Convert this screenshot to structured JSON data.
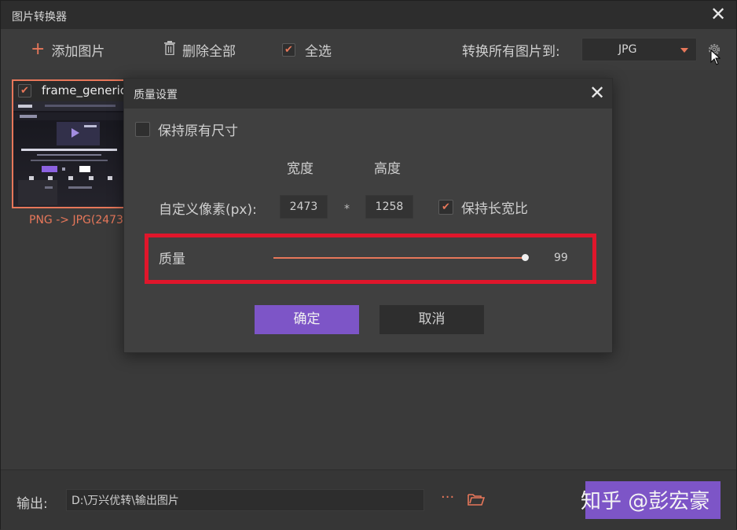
{
  "app": {
    "title": "图片转换器",
    "close_icon": "close-icon"
  },
  "toolbar": {
    "add_label": "添加图片",
    "delete_all_label": "删除全部",
    "select_all_label": "全选",
    "select_all_checked": true,
    "convert_all_label": "转换所有图片到:",
    "format_value": "JPG"
  },
  "item": {
    "name": "frame_generic",
    "caption": "PNG -> JPG(2473",
    "checked": true
  },
  "dialog": {
    "title": "质量设置",
    "keep_original_label": "保持原有尺寸",
    "keep_original_checked": false,
    "width_header": "宽度",
    "height_header": "高度",
    "custom_px_label": "自定义像素(px):",
    "width_value": "2473",
    "times_symbol": "*",
    "height_value": "1258",
    "keep_ratio_label": "保持长宽比",
    "keep_ratio_checked": true,
    "quality_label": "质量",
    "quality_value": "99",
    "ok_label": "确定",
    "cancel_label": "取消"
  },
  "footer": {
    "output_label": "输出:",
    "output_path": "D:\\万兴优转\\输出图片",
    "more_label": "···"
  },
  "watermark": "知乎 @彭宏豪",
  "colors": {
    "accent": "#e7775a",
    "primary": "#7d55c7",
    "highlight": "#e0162b"
  }
}
